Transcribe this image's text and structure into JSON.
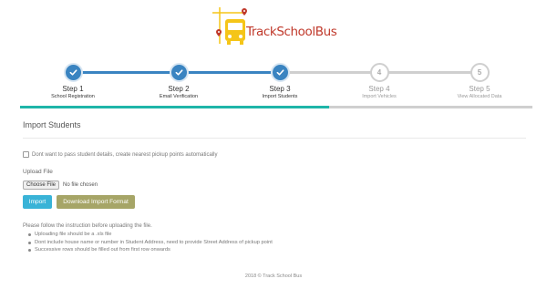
{
  "brand": {
    "name": "TrackSchoolBus",
    "logo_icon": "school-bus-map-pin-icon",
    "accent_red": "#c0392b",
    "bus_yellow": "#f5c518"
  },
  "steps": [
    {
      "title": "Step 1",
      "label": "School Registration",
      "state": "complete",
      "icon": "check-icon"
    },
    {
      "title": "Step 2",
      "label": "Email Verification",
      "state": "complete",
      "icon": "check-icon"
    },
    {
      "title": "Step 3",
      "label": "Import Students",
      "state": "complete",
      "icon": "check-icon"
    },
    {
      "title": "Step 4",
      "label": "Import Vehicles",
      "state": "pending",
      "number": "4"
    },
    {
      "title": "Step 5",
      "label": "View Allocated Data",
      "state": "pending",
      "number": "5"
    }
  ],
  "progress_fraction": 0.6,
  "colors": {
    "step_complete": "#3a84c1",
    "step_pending": "#cfcfcf",
    "progress": "#1fb5a8",
    "import_button": "#39b3d7",
    "download_button": "#a6a567"
  },
  "form": {
    "section_title": "Import Students",
    "auto_pickup_checkbox": {
      "label": "Dont want to pass student details, create nearest pickup points automatically",
      "checked": false
    },
    "upload_label": "Upload File",
    "choose_file_button": "Choose File",
    "file_status": "No file chosen",
    "import_button": "Import",
    "download_button": "Download Import Format"
  },
  "instructions": {
    "intro": "Please follow the instruction before uploading the file.",
    "items": [
      "Uploading file should be a .xls file",
      "Dont include house name or number in Student Address, need to provide Street Address of pickup point",
      "Successive rows should be filled out from first row onwards"
    ]
  },
  "footer": "2018 © Track School Bus"
}
